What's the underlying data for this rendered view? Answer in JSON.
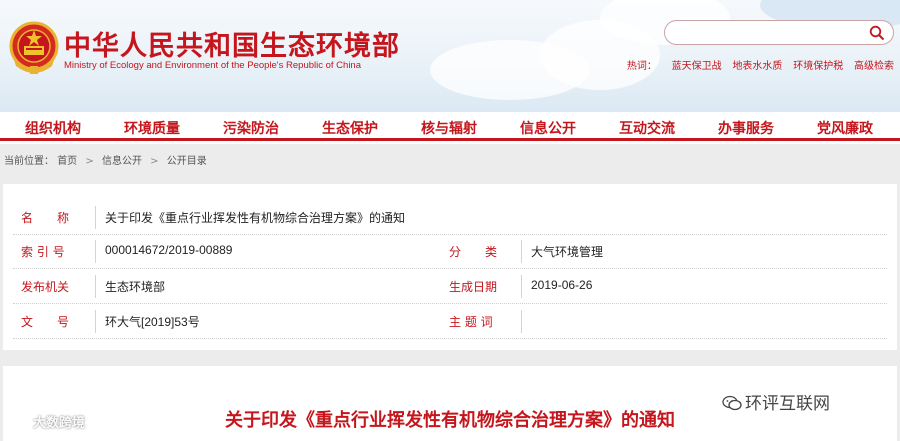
{
  "header": {
    "title": "中华人民共和国生态环境部",
    "subtitle": "Ministry of Ecology and Environment of the People's Republic of China",
    "emblem": "national-emblem",
    "brand_color": "#c4161c"
  },
  "search": {
    "value": "",
    "icon": "search-icon"
  },
  "hot_links": {
    "label": "热词：",
    "items": [
      "蓝天保卫战",
      "地表水水质",
      "环境保护税",
      "高级检索"
    ]
  },
  "nav": {
    "items": [
      "组织机构",
      "环境质量",
      "污染防治",
      "生态保护",
      "核与辐射",
      "信息公开",
      "互动交流",
      "办事服务",
      "党风廉政"
    ]
  },
  "breadcrumb": {
    "prefix": "当前位置：",
    "items": [
      "首页",
      "信息公开",
      "公开目录"
    ],
    "separator": ">"
  },
  "meta": {
    "name_label": "名　　称",
    "name_value": "关于印发《重点行业挥发性有机物综合治理方案》的通知",
    "index_label": "索 引 号",
    "index_value": "000014672/2019-00889",
    "category_label": "分　　类",
    "category_value": "大气环境管理",
    "issuer_label": "发布机关",
    "issuer_value": "生态环境部",
    "date_label": "生成日期",
    "date_value": "2019-06-26",
    "docno_label": "文　　号",
    "docno_value": "环大气[2019]53号",
    "subject_label": "主 题 词",
    "subject_value": ""
  },
  "document": {
    "title": "关于印发《重点行业挥发性有机物综合治理方案》的通知"
  },
  "watermarks": {
    "right": "环评互联网",
    "left": "大数跨境"
  }
}
